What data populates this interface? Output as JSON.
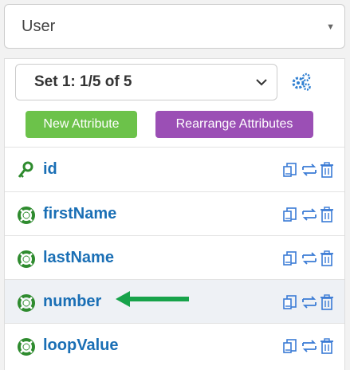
{
  "entity_select": {
    "value": "User",
    "caret": "▼"
  },
  "set_select": {
    "value": "Set 1: 1/5 of 5"
  },
  "buttons": {
    "new_attribute": "New Attribute",
    "rearrange": "Rearrange Attributes"
  },
  "attributes": [
    {
      "name": "id",
      "icon": "key-icon"
    },
    {
      "name": "firstName",
      "icon": "lifebuoy-icon"
    },
    {
      "name": "lastName",
      "icon": "lifebuoy-icon"
    },
    {
      "name": "number",
      "icon": "lifebuoy-icon",
      "highlighted": true,
      "arrow": "green-arrow-icon"
    },
    {
      "name": "loopValue",
      "icon": "lifebuoy-icon"
    }
  ],
  "colors": {
    "link": "#1a6fb5",
    "icon_green": "#2e8b2e",
    "new_button": "#6cc24a",
    "rearrange_button": "#9b4fb5",
    "arrow": "#17a34a",
    "action_blue": "#3a7bd5"
  }
}
